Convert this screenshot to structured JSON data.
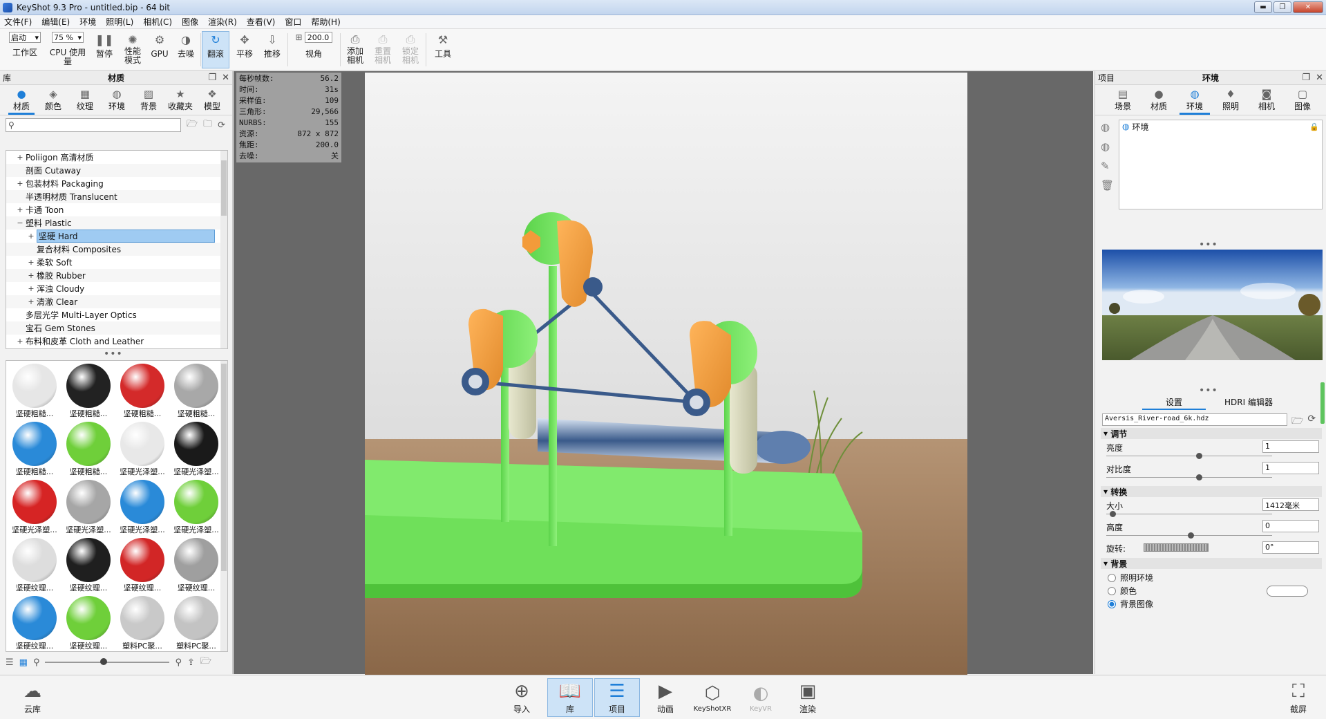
{
  "window": {
    "title": "KeyShot 9.3 Pro  - untitled.bip  - 64 bit",
    "min": "▬",
    "max": "❐",
    "close": "✕"
  },
  "menu": [
    "文件(F)",
    "编辑(E)",
    "环境",
    "照明(L)",
    "相机(C)",
    "图像",
    "渲染(R)",
    "查看(V)",
    "窗口",
    "帮助(H)"
  ],
  "toolbar": {
    "mode_select": "启动",
    "workspace": "工作区",
    "cpu_select": "75 %",
    "cpu_usage": "CPU 使用量",
    "pause": "暂停",
    "perf_mode": "性能\n模式",
    "gpu": "GPU",
    "denoise": "去噪",
    "tumble": "翻滚",
    "pan": "平移",
    "dolly": "推移",
    "fov_value": "200.0",
    "view_angle": "视角",
    "add_camera": "添加\n相机",
    "reset_camera": "重置\n相机",
    "lock_camera": "锁定\n相机",
    "tools": "工具"
  },
  "library": {
    "header": "库",
    "panel_title": "材质",
    "tabs": [
      "材质",
      "颜色",
      "纹理",
      "环境",
      "背景",
      "收藏夹",
      "模型"
    ],
    "active_tab": "材质",
    "tree": [
      {
        "label": "Poliigon 高清材质",
        "indent": 0,
        "exp": "+"
      },
      {
        "label": "剖面 Cutaway",
        "indent": 0,
        "exp": ""
      },
      {
        "label": "包装材料 Packaging",
        "indent": 0,
        "exp": "+"
      },
      {
        "label": "半透明材质 Translucent",
        "indent": 0,
        "exp": ""
      },
      {
        "label": "卡通 Toon",
        "indent": 0,
        "exp": "+"
      },
      {
        "label": "塑料 Plastic",
        "indent": 0,
        "exp": "−"
      },
      {
        "label": "坚硬 Hard",
        "indent": 1,
        "exp": "+",
        "selected": true
      },
      {
        "label": "复合材料 Composites",
        "indent": 1,
        "exp": ""
      },
      {
        "label": "柔软 Soft",
        "indent": 1,
        "exp": "+"
      },
      {
        "label": "橡胶 Rubber",
        "indent": 1,
        "exp": "+"
      },
      {
        "label": "浑浊 Cloudy",
        "indent": 1,
        "exp": "+"
      },
      {
        "label": "清澈 Clear",
        "indent": 1,
        "exp": "+"
      },
      {
        "label": "多层光学 Multi-Layer Optics",
        "indent": 0,
        "exp": ""
      },
      {
        "label": "宝石 Gem Stones",
        "indent": 0,
        "exp": ""
      },
      {
        "label": "布料和皮革 Cloth and Leather",
        "indent": 0,
        "exp": "+"
      }
    ],
    "thumbnails": [
      {
        "label": "坚硬粗糙...",
        "color": "#e6e6e6"
      },
      {
        "label": "坚硬粗糙...",
        "color": "#222222"
      },
      {
        "label": "坚硬粗糙...",
        "color": "#d42a2a"
      },
      {
        "label": "坚硬粗糙...",
        "color": "#a8a8a8"
      },
      {
        "label": "坚硬粗糙...",
        "color": "#2a8ad8"
      },
      {
        "label": "坚硬粗糙...",
        "color": "#6fcf3a"
      },
      {
        "label": "坚硬光泽塑...",
        "color": "#e8e8e8"
      },
      {
        "label": "坚硬光泽塑...",
        "color": "#1a1a1a"
      },
      {
        "label": "坚硬光泽塑...",
        "color": "#d62424"
      },
      {
        "label": "坚硬光泽塑...",
        "color": "#a6a6a6"
      },
      {
        "label": "坚硬光泽塑...",
        "color": "#2a8ad8"
      },
      {
        "label": "坚硬光泽塑...",
        "color": "#6fcf3a"
      },
      {
        "label": "坚硬纹理...",
        "color": "#dddddd"
      },
      {
        "label": "坚硬纹理...",
        "color": "#1f1f1f"
      },
      {
        "label": "坚硬纹理...",
        "color": "#d22626"
      },
      {
        "label": "坚硬纹理...",
        "color": "#9f9f9f"
      },
      {
        "label": "坚硬纹理...",
        "color": "#2a8ad8"
      },
      {
        "label": "坚硬纹理...",
        "color": "#6fcf3a"
      },
      {
        "label": "塑料PC聚...",
        "color": "#c9c9c9"
      },
      {
        "label": "塑料PC聚...",
        "color": "#c3c3c3"
      }
    ]
  },
  "hud": [
    {
      "k": "每秒帧数:",
      "v": "56.2"
    },
    {
      "k": "时间:",
      "v": "31s"
    },
    {
      "k": "采样值:",
      "v": "109"
    },
    {
      "k": "三角形:",
      "v": "29,566"
    },
    {
      "k": "NURBS:",
      "v": "155"
    },
    {
      "k": "资源:",
      "v": "872 x 872"
    },
    {
      "k": "焦距:",
      "v": "200.0"
    },
    {
      "k": "去噪:",
      "v": "关"
    }
  ],
  "project": {
    "header": "项目",
    "panel_title": "环境",
    "tabs": [
      "场景",
      "材质",
      "环境",
      "照明",
      "相机",
      "图像"
    ],
    "active_tab": "环境",
    "env_item": "环境",
    "subtabs": [
      "设置",
      "HDRI 编辑器"
    ],
    "hdri_file": "Aversis_River-road_6k.hdz",
    "sections": {
      "adjust": "调节",
      "transform": "转换",
      "background": "背景"
    },
    "brightness": {
      "label": "亮度",
      "value": "1",
      "knob_pct": 0.55
    },
    "contrast": {
      "label": "对比度",
      "value": "1",
      "knob_pct": 0.55
    },
    "size": {
      "label": "大小",
      "value": "1412毫米",
      "knob_pct": 0.02
    },
    "height": {
      "label": "高度",
      "value": "0",
      "knob_pct": 0.5
    },
    "rotation": {
      "label": "旋转:",
      "value": "0°"
    },
    "bg_options": [
      {
        "label": "照明环境",
        "on": false
      },
      {
        "label": "颜色",
        "on": false
      },
      {
        "label": "背景图像",
        "on": true
      }
    ]
  },
  "bottom": [
    {
      "label": "云库",
      "icon": "☁"
    },
    {
      "label": "导入",
      "icon": "⊕"
    },
    {
      "label": "库",
      "icon": "📖",
      "active": true
    },
    {
      "label": "项目",
      "icon": "☰",
      "active": true
    },
    {
      "label": "动画",
      "icon": "▶"
    },
    {
      "label": "KeyShotXR",
      "icon": "⬡"
    },
    {
      "label": "KeyVR",
      "icon": "◐",
      "disabled": true
    },
    {
      "label": "渲染",
      "icon": "▣"
    },
    {
      "label": "截屏",
      "icon": "⛶"
    }
  ]
}
